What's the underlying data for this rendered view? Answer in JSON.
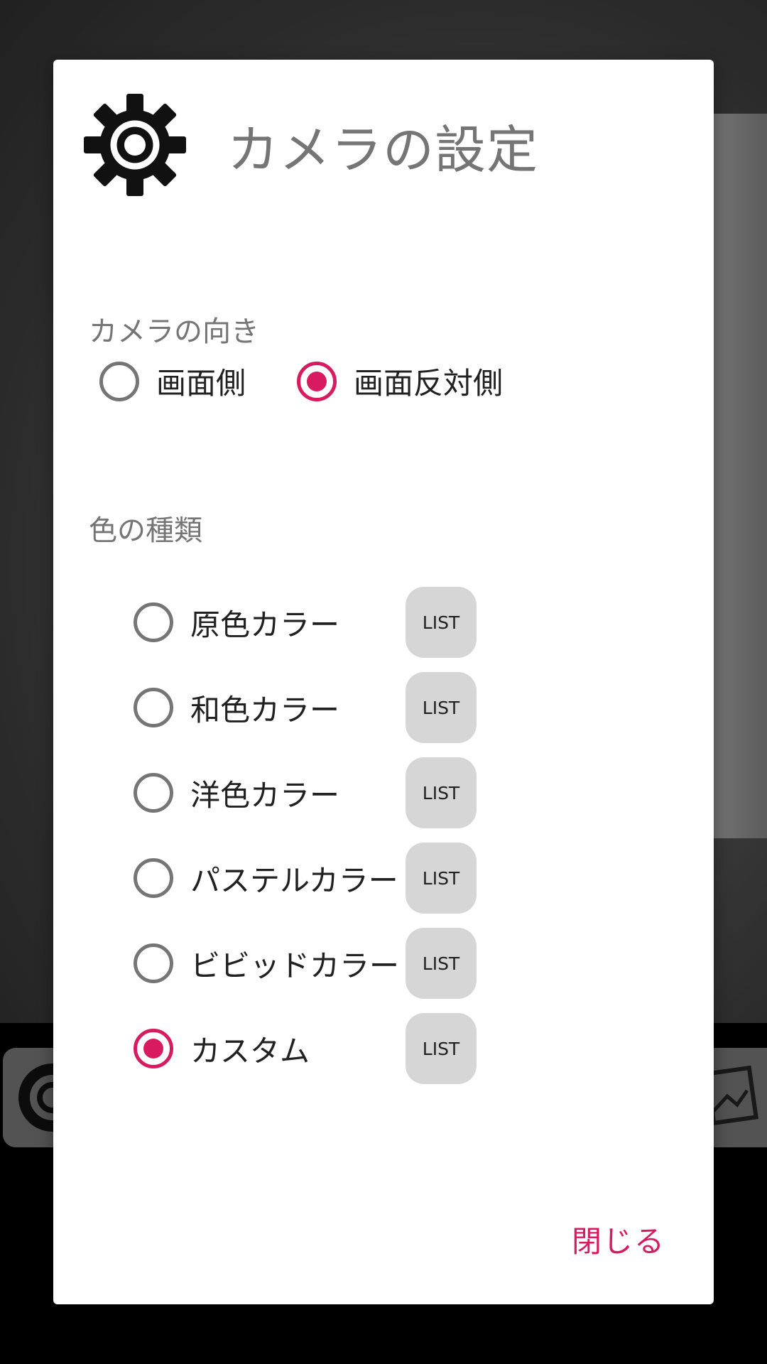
{
  "dialog": {
    "title": "カメラの設定",
    "close_label": "閉じる",
    "accent_color": "#d81b60"
  },
  "camera_direction": {
    "label": "カメラの向き",
    "options": [
      {
        "label": "画面側",
        "selected": false
      },
      {
        "label": "画面反対側",
        "selected": true
      }
    ]
  },
  "color_type": {
    "label": "色の種類",
    "options": [
      {
        "label": "原色カラー",
        "selected": false,
        "button": "LIST"
      },
      {
        "label": "和色カラー",
        "selected": false,
        "button": "LIST"
      },
      {
        "label": "洋色カラー",
        "selected": false,
        "button": "LIST"
      },
      {
        "label": "パステルカラー",
        "selected": false,
        "button": "LIST"
      },
      {
        "label": "ビビッドカラー",
        "selected": false,
        "button": "LIST"
      },
      {
        "label": "カスタム",
        "selected": true,
        "button": "LIST"
      }
    ]
  },
  "icons": {
    "title_icon": "gear-icon",
    "background_left": "gear-icon",
    "background_right": "gallery-icon"
  }
}
